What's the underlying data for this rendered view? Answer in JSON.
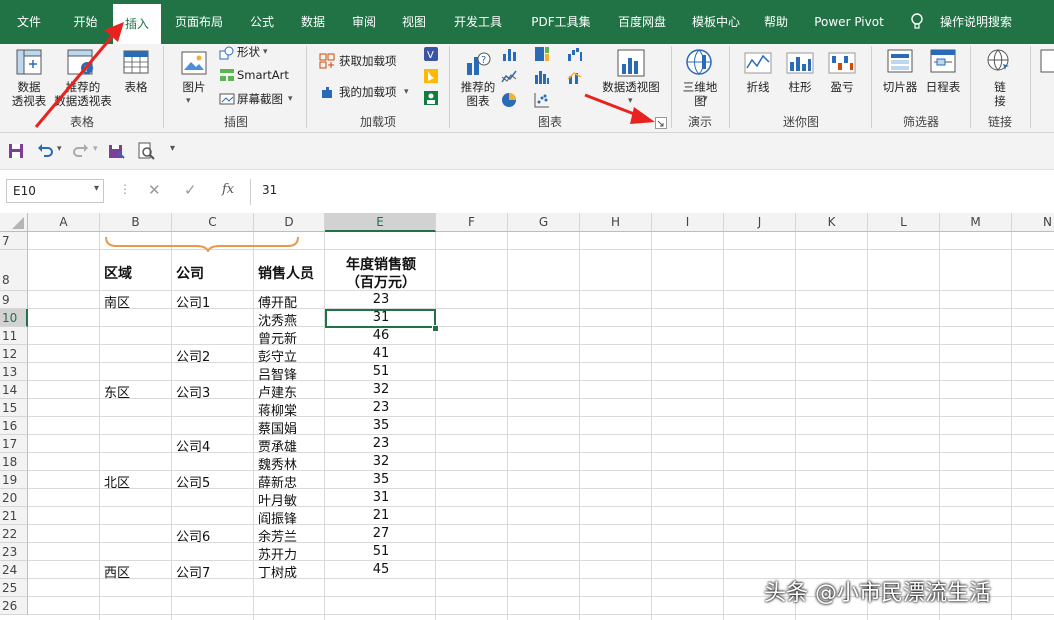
{
  "tabs": [
    "文件",
    "开始",
    "插入",
    "页面布局",
    "公式",
    "数据",
    "审阅",
    "视图",
    "开发工具",
    "PDF工具集",
    "百度网盘",
    "模板中心",
    "帮助",
    "Power Pivot",
    "操作说明搜索"
  ],
  "ribbon": {
    "groups": [
      "表格",
      "插图",
      "加载项",
      "图表",
      "演示",
      "迷你图",
      "筛选器",
      "链接"
    ],
    "pivot_label": "数据\n透视表",
    "recommended_pivot_label": "推荐的\n数据透视表",
    "table_label": "表格",
    "picture_label": "图片",
    "shapes_label": "形状",
    "smartart_label": "SmartArt",
    "screenshot_label": "屏幕截图",
    "get_addins_label": "获取加载项",
    "my_addins_label": "我的加载项",
    "recommended_charts_label": "推荐的\n图表",
    "pivot_chart_label": "数据透视图",
    "map3d_label": "三维地\n图",
    "spark_line_label": "折线",
    "spark_column_label": "柱形",
    "spark_winloss_label": "盈亏",
    "slicer_label": "切片器",
    "timeline_label": "日程表",
    "link_label": "链\n接"
  },
  "formula_bar": {
    "name_box": "E10",
    "value": "31",
    "fx": "fx"
  },
  "columns": [
    "A",
    "B",
    "C",
    "D",
    "E",
    "F",
    "G",
    "H",
    "I",
    "J",
    "K",
    "L",
    "M",
    "N"
  ],
  "rows": [
    "7",
    "8",
    "9",
    "10",
    "11",
    "12",
    "13",
    "14",
    "15",
    "16",
    "17",
    "18",
    "19",
    "20",
    "21",
    "22",
    "23",
    "24",
    "25",
    "26"
  ],
  "headers": {
    "region": "区域",
    "company": "公司",
    "salesperson": "销售人员",
    "annual_sales_l1": "年度销售额",
    "annual_sales_l2": "（百万元）"
  },
  "table": [
    {
      "row": "9",
      "region": "南区",
      "company": "公司1",
      "person": "傅开配",
      "sales": "23"
    },
    {
      "row": "10",
      "region": "",
      "company": "",
      "person": "沈秀燕",
      "sales": "31"
    },
    {
      "row": "11",
      "region": "",
      "company": "",
      "person": "曾元新",
      "sales": "46"
    },
    {
      "row": "12",
      "region": "",
      "company": "公司2",
      "person": "彭守立",
      "sales": "41"
    },
    {
      "row": "13",
      "region": "",
      "company": "",
      "person": "吕智锋",
      "sales": "51"
    },
    {
      "row": "14",
      "region": "东区",
      "company": "公司3",
      "person": "卢建东",
      "sales": "32"
    },
    {
      "row": "15",
      "region": "",
      "company": "",
      "person": "蒋柳棠",
      "sales": "23"
    },
    {
      "row": "16",
      "region": "",
      "company": "",
      "person": "蔡国娟",
      "sales": "35"
    },
    {
      "row": "17",
      "region": "",
      "company": "公司4",
      "person": "贾承雄",
      "sales": "23"
    },
    {
      "row": "18",
      "region": "",
      "company": "",
      "person": "魏秀林",
      "sales": "32"
    },
    {
      "row": "19",
      "region": "北区",
      "company": "公司5",
      "person": "薛新忠",
      "sales": "35"
    },
    {
      "row": "20",
      "region": "",
      "company": "",
      "person": "叶月敏",
      "sales": "31"
    },
    {
      "row": "21",
      "region": "",
      "company": "",
      "person": "阎振锋",
      "sales": "21"
    },
    {
      "row": "22",
      "region": "",
      "company": "公司6",
      "person": "余芳兰",
      "sales": "27"
    },
    {
      "row": "23",
      "region": "",
      "company": "",
      "person": "苏开力",
      "sales": "51"
    },
    {
      "row": "24",
      "region": "西区",
      "company": "公司7",
      "person": "丁树成",
      "sales": "45"
    }
  ],
  "watermark": "头条 @小市民漂流生活",
  "colors": {
    "excel_green": "#217346",
    "arrow_red": "#e8231f",
    "brace_orange": "#e8994a"
  }
}
